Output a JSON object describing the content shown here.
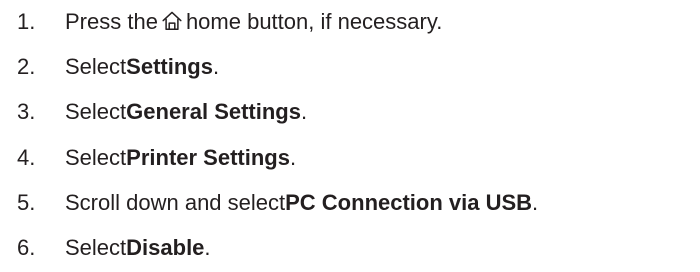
{
  "steps": [
    {
      "number": "1.",
      "before": "Press the",
      "icon": "home-icon",
      "after": "home button, if necessary."
    },
    {
      "number": "2.",
      "before": "Select ",
      "bold": "Settings",
      "after": "."
    },
    {
      "number": "3.",
      "before": "Select ",
      "bold": "General Settings",
      "after": "."
    },
    {
      "number": "4.",
      "before": "Select ",
      "bold": "Printer Settings",
      "after": "."
    },
    {
      "number": "5.",
      "before": "Scroll down and select ",
      "bold": "PC Connection via USB",
      "after": "."
    },
    {
      "number": "6.",
      "before": "Select ",
      "bold": "Disable",
      "after": "."
    }
  ]
}
